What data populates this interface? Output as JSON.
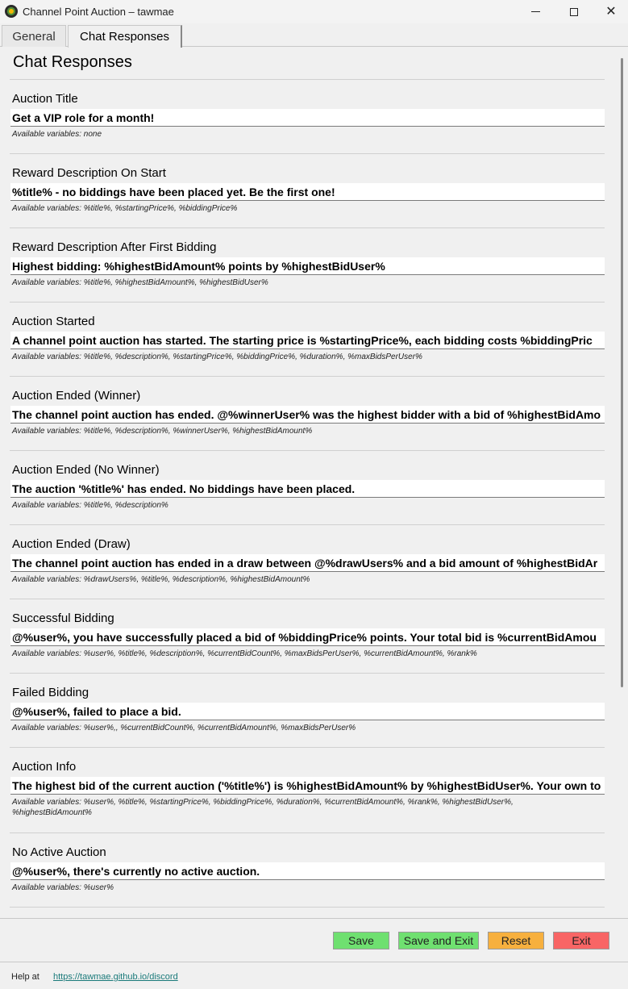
{
  "window": {
    "title": "Channel Point Auction – tawmae",
    "min_symbol": "",
    "close_symbol": "✕"
  },
  "tabs": [
    {
      "label": "General",
      "active": false
    },
    {
      "label": "Chat Responses",
      "active": true
    }
  ],
  "page": {
    "title": "Chat Responses"
  },
  "sections": [
    {
      "label": "Auction Title",
      "value": "Get a VIP role for a month!",
      "vars": "Available variables: none"
    },
    {
      "label": "Reward Description On Start",
      "value": "%title% - no biddings have been placed yet. Be the first one!",
      "vars": "Available variables: %title%, %startingPrice%, %biddingPrice%"
    },
    {
      "label": "Reward Description After First Bidding",
      "value": "Highest bidding: %highestBidAmount% points by %highestBidUser%",
      "vars": "Available variables: %title%, %highestBidAmount%, %highestBidUser%"
    },
    {
      "label": "Auction Started",
      "value": "A channel point auction has started. The starting price is %startingPrice%, each bidding costs %biddingPric",
      "vars": "Available variables: %title%, %description%, %startingPrice%, %biddingPrice%, %duration%, %maxBidsPerUser%"
    },
    {
      "label": "Auction Ended (Winner)",
      "value": "The channel point auction has ended. @%winnerUser% was the highest bidder with a bid of %highestBidAmo",
      "vars": "Available variables: %title%, %description%, %winnerUser%, %highestBidAmount%"
    },
    {
      "label": "Auction Ended (No Winner)",
      "value": "The auction '%title%' has ended. No biddings have been placed.",
      "vars": "Available variables: %title%, %description%"
    },
    {
      "label": "Auction Ended (Draw)",
      "value": "The channel point auction has ended in a draw between @%drawUsers% and a bid amount of %highestBidAr",
      "vars": "Available variables: %drawUsers%, %title%, %description%, %highestBidAmount%"
    },
    {
      "label": "Successful Bidding",
      "value": "@%user%, you have successfully placed a bid of %biddingPrice% points. Your total bid is %currentBidAmou",
      "vars": "Available variables: %user%, %title%, %description%, %currentBidCount%, %maxBidsPerUser%, %currentBidAmount%, %rank%"
    },
    {
      "label": "Failed Bidding",
      "value": "@%user%, failed to place a bid.",
      "vars": "Available variables: %user%,, %currentBidCount%, %currentBidAmount%, %maxBidsPerUser%"
    },
    {
      "label": "Auction Info",
      "value": "The highest bid of the current auction ('%title%') is %highestBidAmount% by %highestBidUser%. Your own to",
      "vars": "Available variables: %user%, %title%, %startingPrice%, %biddingPrice%, %duration%, %currentBidAmount%, %rank%, %highestBidUser%, %highestBidAmount%"
    },
    {
      "label": "No Active Auction",
      "value": "@%user%, there's currently no active auction.",
      "vars": "Available variables: %user%"
    }
  ],
  "buttons": {
    "save": "Save",
    "save_exit": "Save and Exit",
    "reset": "Reset",
    "exit": "Exit"
  },
  "footer": {
    "help_label": "Help at",
    "help_link": "https://tawmae.github.io/discord"
  },
  "colors": {
    "save": "#6fe070",
    "reset": "#f7b03e",
    "exit": "#f86565",
    "link": "#1a7a7a"
  }
}
